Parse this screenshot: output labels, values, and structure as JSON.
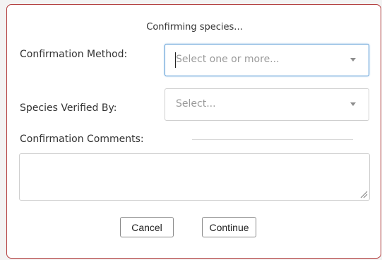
{
  "dialog": {
    "title": "Confirming species...",
    "fields": {
      "method": {
        "label": "Confirmation Method:",
        "placeholder": "Select one or more..."
      },
      "verified_by": {
        "label": "Species Verified By:",
        "placeholder": "Select..."
      },
      "comments": {
        "label": "Confirmation Comments:",
        "value": ""
      }
    },
    "buttons": {
      "cancel": "Cancel",
      "continue": "Continue"
    }
  },
  "icons": {
    "dropdown": "chevron-down-icon",
    "resize": "resize-grip-icon"
  },
  "colors": {
    "dialog_border": "#b23b3b",
    "focus_border": "#5b9bd5"
  }
}
